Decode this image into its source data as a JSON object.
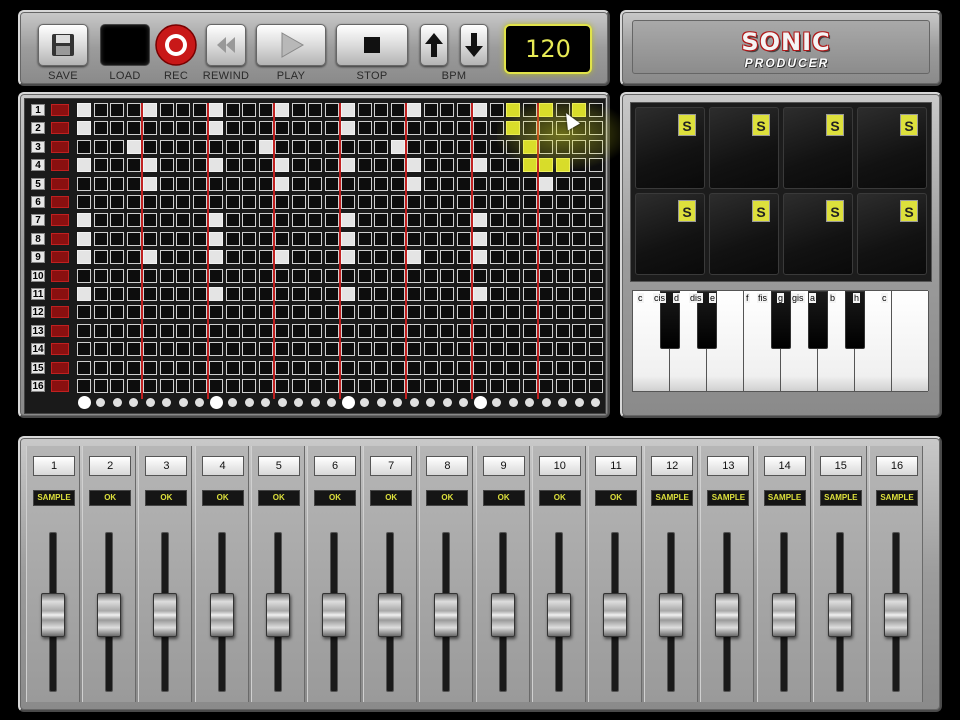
{
  "transport": {
    "save_label": "SAVE",
    "load_label": "LOAD",
    "rec_label": "REC",
    "rewind_label": "REWIND",
    "play_label": "PLAY",
    "stop_label": "STOP",
    "bpm_label": "BPM",
    "bpm_value": "120"
  },
  "brand": {
    "logo_main": "SONIC",
    "logo_sub": "PRODUCER"
  },
  "sequencer": {
    "rows": [
      "1",
      "2",
      "3",
      "4",
      "5",
      "6",
      "7",
      "8",
      "9",
      "10",
      "11",
      "12",
      "13",
      "14",
      "15",
      "16"
    ],
    "active_steps": {
      "1": [
        1,
        5,
        9,
        13,
        17,
        21,
        25,
        29
      ],
      "2": [
        1,
        9,
        17
      ],
      "3": [
        4,
        12,
        20
      ],
      "4": [
        1,
        5,
        9,
        13,
        17,
        21,
        25
      ],
      "5": [
        5,
        13,
        21,
        29
      ],
      "7": [
        1,
        9,
        17,
        25
      ],
      "8": [
        1,
        9,
        17,
        25
      ],
      "9": [
        1,
        5,
        9,
        13,
        17,
        21,
        25
      ],
      "11": [
        1,
        9,
        17,
        25
      ]
    },
    "highlighted_steps": {
      "1": [
        27,
        29,
        31
      ],
      "2": [
        27
      ],
      "3": [
        28
      ],
      "4": [
        28,
        29,
        30
      ]
    }
  },
  "pads": {
    "labels": [
      "S",
      "S",
      "S",
      "S",
      "S",
      "S",
      "S",
      "S"
    ]
  },
  "keyboard": {
    "note_labels": [
      "c",
      "cis",
      "d",
      "dis",
      "e",
      "f",
      "fis",
      "g",
      "gis",
      "a",
      "b",
      "h",
      "c"
    ]
  },
  "mixer": {
    "channels": [
      {
        "num": "1",
        "tag": "SAMPLE",
        "level": 0.47
      },
      {
        "num": "2",
        "tag": "OK",
        "level": 0.47
      },
      {
        "num": "3",
        "tag": "OK",
        "level": 0.47
      },
      {
        "num": "4",
        "tag": "OK",
        "level": 0.47
      },
      {
        "num": "5",
        "tag": "OK",
        "level": 0.47
      },
      {
        "num": "6",
        "tag": "OK",
        "level": 0.47
      },
      {
        "num": "7",
        "tag": "OK",
        "level": 0.47
      },
      {
        "num": "8",
        "tag": "OK",
        "level": 0.47
      },
      {
        "num": "9",
        "tag": "OK",
        "level": 0.47
      },
      {
        "num": "10",
        "tag": "OK",
        "level": 0.47
      },
      {
        "num": "11",
        "tag": "OK",
        "level": 0.47
      },
      {
        "num": "12",
        "tag": "SAMPLE",
        "level": 0.47
      },
      {
        "num": "13",
        "tag": "SAMPLE",
        "level": 0.47
      },
      {
        "num": "14",
        "tag": "SAMPLE",
        "level": 0.47
      },
      {
        "num": "15",
        "tag": "SAMPLE",
        "level": 0.47
      },
      {
        "num": "16",
        "tag": "SAMPLE",
        "level": 0.47
      }
    ]
  },
  "colors": {
    "accent_yellow": "#dde03c",
    "bar_line_red": "#c02020",
    "mute_red": "#8a1010"
  }
}
